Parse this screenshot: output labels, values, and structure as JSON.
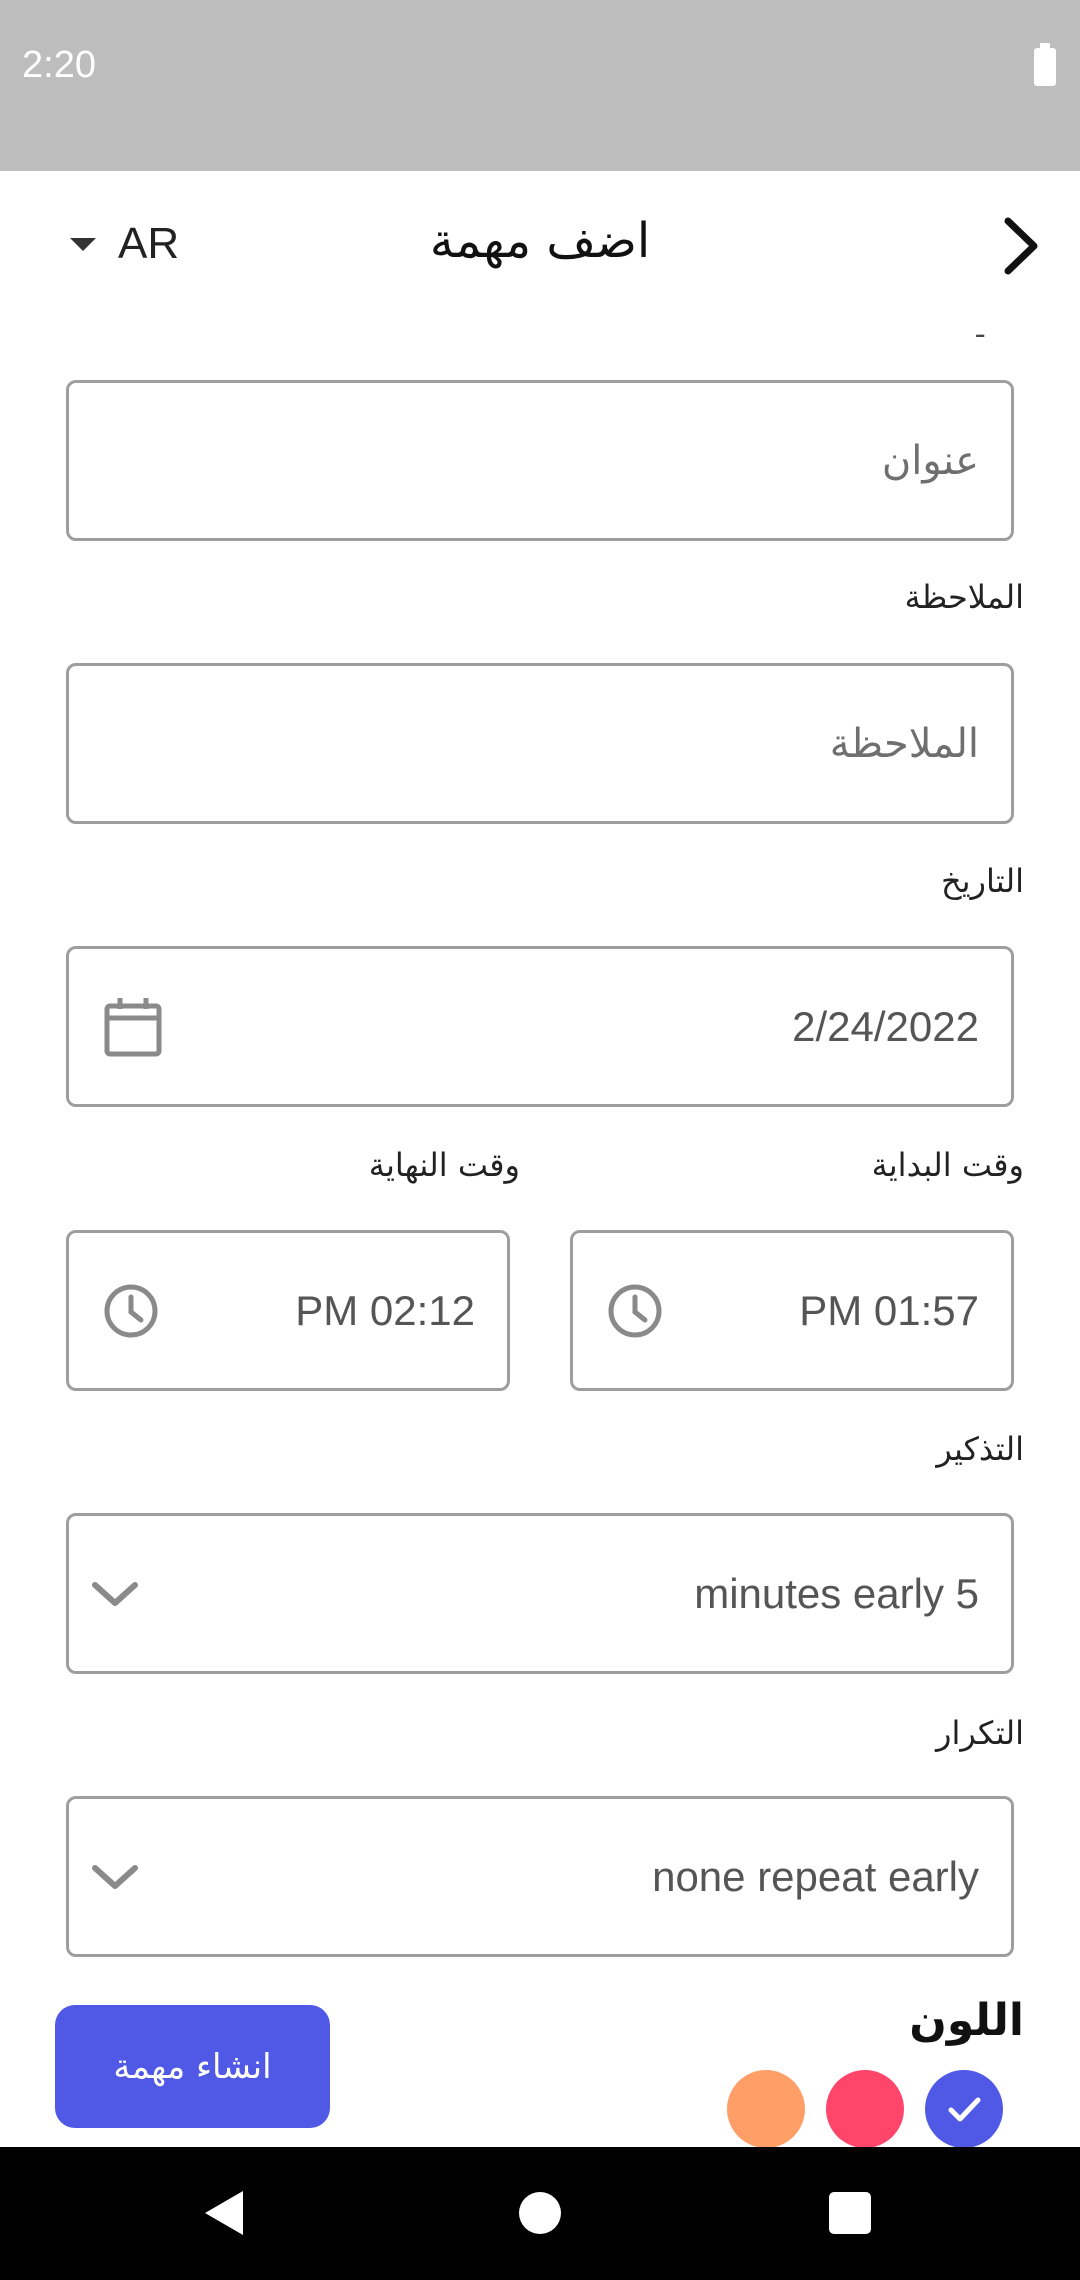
{
  "status_bar": {
    "time": "2:20"
  },
  "app_bar": {
    "title": "اضف مهمة",
    "language": "AR"
  },
  "form": {
    "title_field": {
      "top_label": "ـ",
      "placeholder": "عنوان"
    },
    "note": {
      "label": "الملاحظة",
      "placeholder": "الملاحظة"
    },
    "date": {
      "label": "التاريخ",
      "value": "2/24/2022"
    },
    "start_time": {
      "label": "وقت البداية",
      "value": "PM 01:57"
    },
    "end_time": {
      "label": "وقت النهاية",
      "value": "PM 02:12"
    },
    "reminder": {
      "label": "التذكير",
      "value": "minutes early 5"
    },
    "repeat": {
      "label": "التكرار",
      "value": "none repeat early"
    }
  },
  "color_picker": {
    "label": "اللون",
    "swatches": [
      {
        "name": "orange",
        "color": "#ff9e66",
        "selected": false
      },
      {
        "name": "pink",
        "color": "#ff4569",
        "selected": false
      },
      {
        "name": "indigo",
        "color": "#5059e6",
        "selected": true
      }
    ]
  },
  "create_button": {
    "label": "انشاء مهمة"
  },
  "icons": {
    "forward": "chevron-right-icon",
    "language_dropdown": "caret-down-icon",
    "date": "calendar-icon",
    "time": "clock-icon",
    "dropdown": "chevron-down-icon",
    "selected_swatch": "check-icon"
  }
}
